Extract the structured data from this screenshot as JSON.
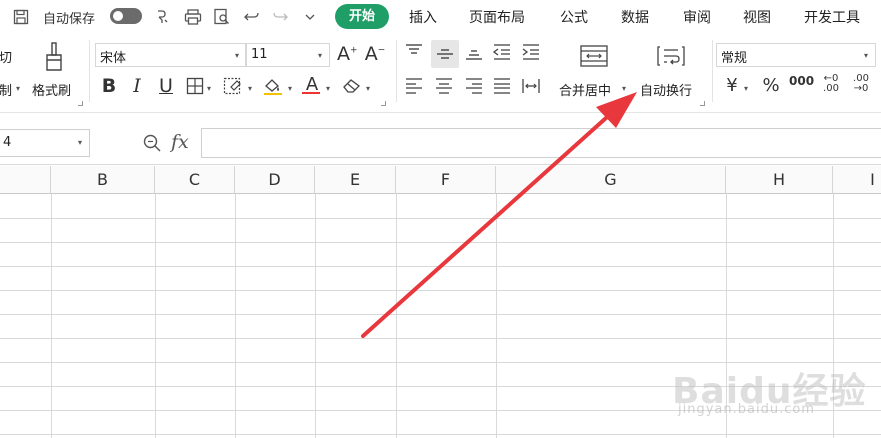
{
  "topbar": {
    "autosave_label": "自动保存",
    "tabs": [
      "开始",
      "插入",
      "页面布局",
      "公式",
      "数据",
      "审阅",
      "视图",
      "开发工具"
    ],
    "accent_color": "#1f9f67"
  },
  "ribbon": {
    "cut_label": "切",
    "paste_label": "制",
    "format_painter_label": "格式刷",
    "font_name": "宋体",
    "font_size": "11",
    "merge_label": "合并居中",
    "wrap_label": "自动换行",
    "number_format": "常规",
    "currency_symbol": "¥",
    "percent_symbol": "%",
    "thousands_symbol": "000",
    "dec_increase": "←0\n.00",
    "dec_decrease": ".00\n→0"
  },
  "formula": {
    "name_box": "4",
    "fx_label": "fx",
    "content": ""
  },
  "grid": {
    "columns": [
      "B",
      "C",
      "D",
      "E",
      "F",
      "G",
      "H",
      "I"
    ]
  },
  "annotation": {
    "arrow_color": "#e8383d"
  },
  "watermark": {
    "main": "Baidu经验",
    "sub": "jingyan.baidu.com"
  }
}
